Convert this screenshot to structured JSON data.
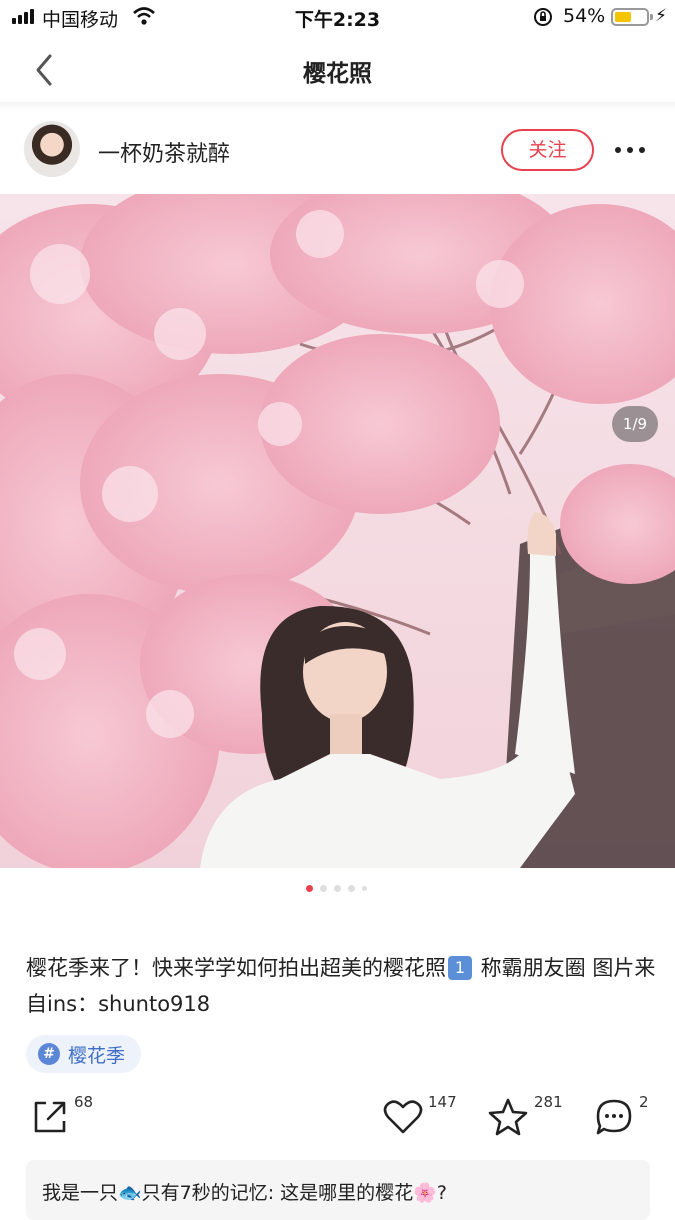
{
  "status_bar": {
    "carrier": "中国移动",
    "time": "下午2:23",
    "battery_percent_label": "54%",
    "battery_level": 0.54
  },
  "nav": {
    "title": "樱花照"
  },
  "author": {
    "name": "一杯奶茶就醉",
    "follow_label": "关注"
  },
  "photo": {
    "counter": "1/9",
    "page_count": 5,
    "active_page": 1
  },
  "post": {
    "caption_part1": "樱花季来了！快来学学如何拍出超美的樱花照",
    "caption_badge": "1",
    "caption_part2": " 称霸朋友圈 图片来自ins：shunto918",
    "tag": "樱花季"
  },
  "actions": {
    "share_count": "68",
    "like_count": "147",
    "favorite_count": "281",
    "comment_count": "2"
  },
  "comment_preview": {
    "text": "我是一只🐟只有7秒的记忆: 这是哪里的樱花🌸?"
  },
  "icons": {
    "back": "chevron-left-icon",
    "more": "more-dots-icon",
    "share": "share-icon",
    "like": "heart-icon",
    "favorite": "star-icon",
    "comment": "comment-bubble-icon"
  },
  "colors": {
    "accent": "#e8424f",
    "tag_text": "#3f6fc4",
    "tag_bg": "#eef2fa",
    "active_dot": "#e8424f"
  }
}
